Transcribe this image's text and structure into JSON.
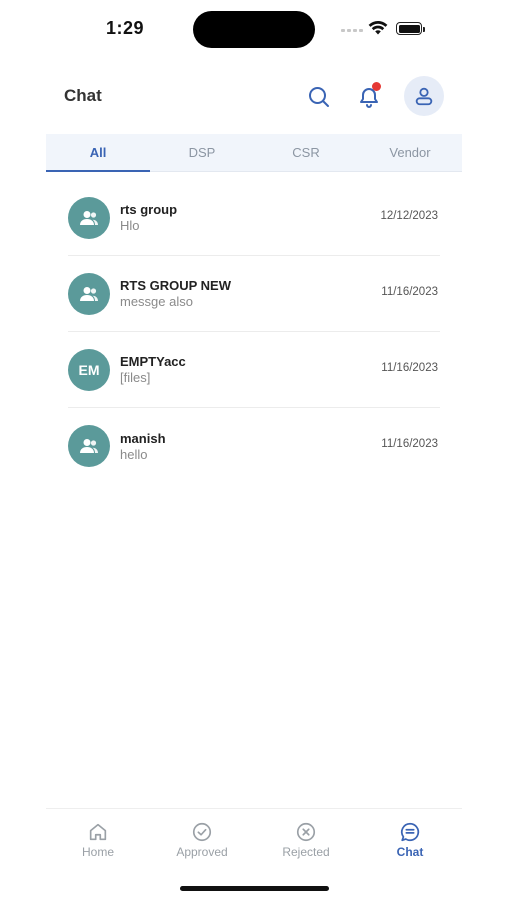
{
  "status_bar": {
    "time": "1:29",
    "icons": [
      "signal-icon",
      "wifi-icon",
      "battery-icon"
    ]
  },
  "header": {
    "title": "Chat",
    "icons": [
      "search-icon",
      "bell-icon",
      "user-icon"
    ],
    "notification_dot_color": "#e53935"
  },
  "tabs": [
    {
      "label": "All",
      "active": true
    },
    {
      "label": "DSP",
      "active": false
    },
    {
      "label": "CSR",
      "active": false
    },
    {
      "label": "Vendor",
      "active": false
    }
  ],
  "chats": [
    {
      "name": "rts group",
      "message": "Hlo",
      "date": "12/12/2023",
      "avatar": "group-icon"
    },
    {
      "name": "RTS GROUP NEW",
      "message": "messge also",
      "date": "11/16/2023",
      "avatar": "group-icon"
    },
    {
      "name": "EMPTYacc",
      "message": "[files]",
      "date": "11/16/2023",
      "avatar_initials": "EM"
    },
    {
      "name": "manish",
      "message": "hello",
      "date": "11/16/2023",
      "avatar": "group-icon"
    }
  ],
  "bottom_nav": [
    {
      "label": "Home",
      "icon": "home-icon",
      "active": false
    },
    {
      "label": "Approved",
      "icon": "check-circle-icon",
      "active": false
    },
    {
      "label": "Rejected",
      "icon": "x-circle-icon",
      "active": false
    },
    {
      "label": "Chat",
      "icon": "chat-icon",
      "active": true
    }
  ],
  "colors": {
    "accent": "#3a64b4",
    "avatar_bg": "#5b9a9a",
    "tab_bg": "#f1f5fb"
  }
}
